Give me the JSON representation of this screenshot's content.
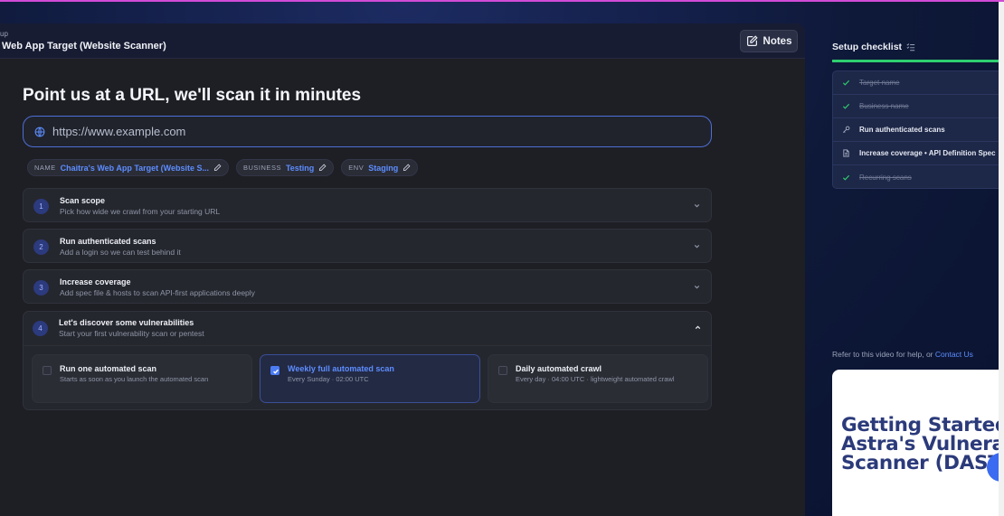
{
  "header": {
    "breadcrumb": "up",
    "title": "Web App Target (Website Scanner)",
    "notes_label": "Notes"
  },
  "main": {
    "headline": "Point us at a URL, we'll scan it in minutes",
    "url_placeholder": "https://www.example.com",
    "chips": [
      {
        "key": "NAME",
        "value": "Chaitra's Web App Target (Website S..."
      },
      {
        "key": "BUSINESS",
        "value": "Testing"
      },
      {
        "key": "ENV",
        "value": "Staging"
      }
    ],
    "steps": [
      {
        "num": "1",
        "title": "Scan scope",
        "subtitle": "Pick how wide we crawl from your starting URL"
      },
      {
        "num": "2",
        "title": "Run authenticated scans",
        "subtitle": "Add a login so we can test behind it"
      },
      {
        "num": "3",
        "title": "Increase coverage",
        "subtitle": "Add spec file & hosts to scan API-first applications deeply"
      },
      {
        "num": "4",
        "title": "Let's discover some vulnerabilities",
        "subtitle": "Start your first vulnerability scan or pentest"
      }
    ],
    "scan_options": [
      {
        "title": "Run one automated scan",
        "desc": "Starts as soon as you launch the automated scan",
        "selected": false
      },
      {
        "title": "Weekly full automated scan",
        "desc": "Every Sunday · 02:00 UTC",
        "selected": true
      },
      {
        "title": "Daily automated crawl",
        "desc": "Every day · 04:00 UTC · lightweight automated crawl",
        "selected": false
      }
    ]
  },
  "checklist": {
    "title": "Setup checklist",
    "items": [
      {
        "label": "Target name",
        "done": true
      },
      {
        "label": "Business name",
        "done": true
      },
      {
        "label": "Run authenticated scans",
        "done": false,
        "icon": "key-icon"
      },
      {
        "label": "Increase coverage • API Definition Spec",
        "done": false,
        "icon": "document-icon"
      },
      {
        "label": "Recurring scans",
        "done": true
      }
    ]
  },
  "help": {
    "text": "Refer to this video for help, or ",
    "link": "Contact Us"
  },
  "video": {
    "title": "Getting Started with Astra's Vulnerability Scanner (DAST)"
  },
  "colors": {
    "accent": "#5d8dff",
    "progress": "#2fcf6f",
    "video_text": "#2b3a7a"
  }
}
